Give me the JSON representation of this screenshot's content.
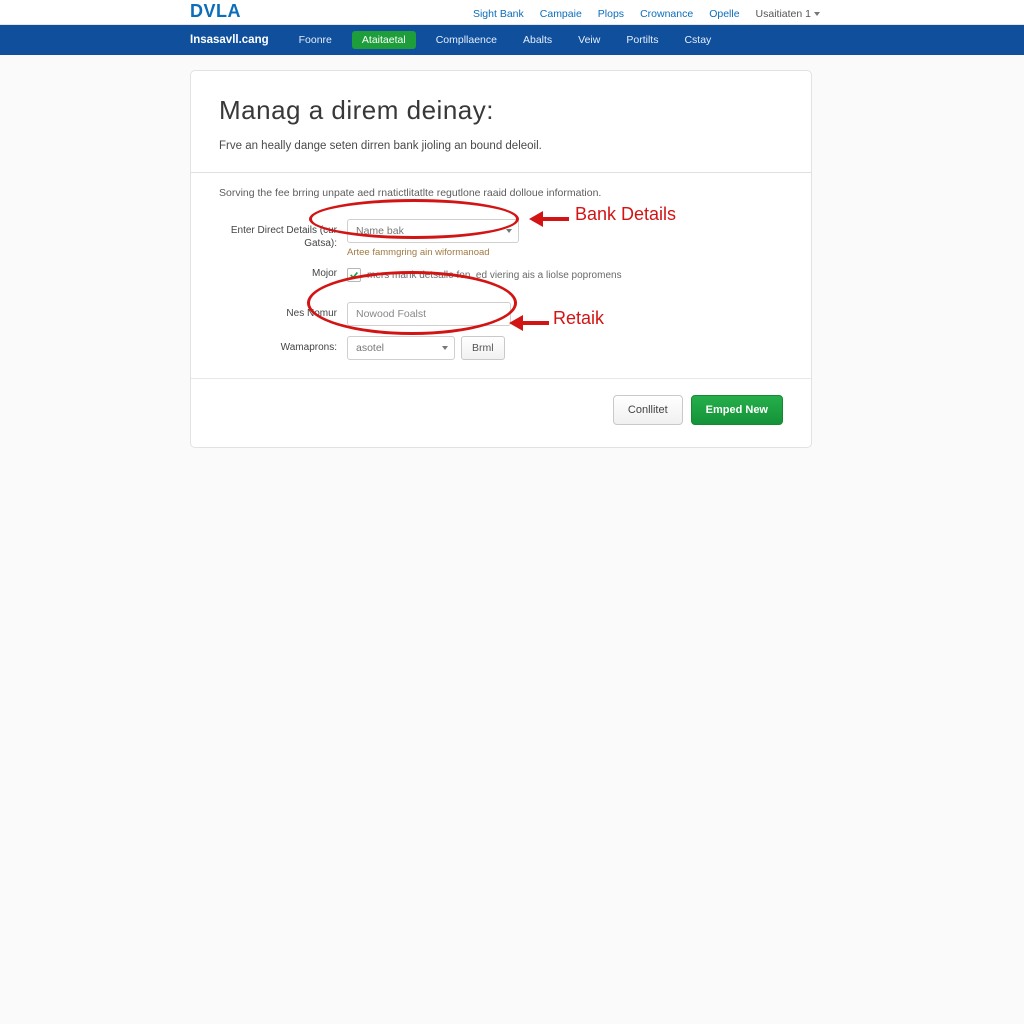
{
  "header": {
    "logo": "DVLA",
    "links": [
      "Sight Bank",
      "Campaie",
      "Plops",
      "Crownance",
      "Opelle"
    ],
    "user_menu": "Usaitiaten 1"
  },
  "nav": {
    "brand": "Insasavll.cang",
    "items": [
      "Foonre",
      "Ataitaetal",
      "Compllaence",
      "Abalts",
      "Veiw",
      "Portilts",
      "Cstay"
    ],
    "active_index": 1
  },
  "page": {
    "title": "Manag a direm deinay:",
    "lede": "Frve an heally dange seten dirren bank jioling an bound deleoil.",
    "helper": "Sorving the fee brring unpate aed rnatictlitatlte regutlone raaid dolloue information."
  },
  "form": {
    "enter_details_label": "Enter Direct Details\n(cur Gatsa):",
    "bank_select_value": "Name bak",
    "bank_hint": "Artee fammgring ain wiformanoad",
    "major_label": "Mojor",
    "major_caption": "mers mank detsalle fon, ed viering ais a liolse popromens",
    "major_checked": true,
    "new_label": "Nes Nomur",
    "new_placeholder": "Nowood Foalst",
    "wamo_label": "Wamaprons:",
    "wamo_value": "asotel",
    "wamo_btn": "Brml"
  },
  "footer": {
    "cancel": "Conllitet",
    "primary": "Emped New"
  },
  "annotations": {
    "bank_label": "Bank Details",
    "retail_label": "Retaik"
  }
}
